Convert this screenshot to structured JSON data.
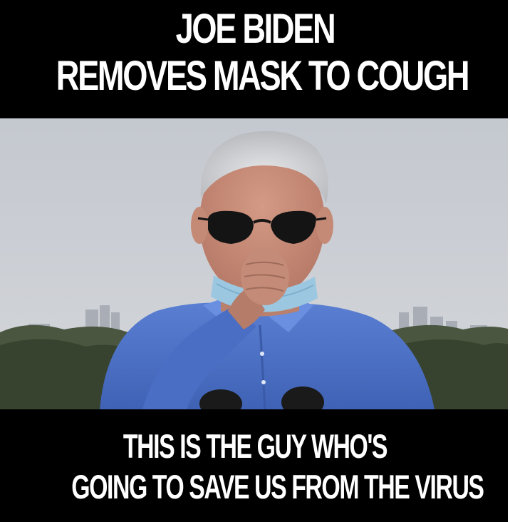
{
  "meme": {
    "top_caption": [
      "JOE BIDEN",
      "REMOVES MASK TO COUGH"
    ],
    "bottom_caption": [
      "THIS IS THE GUY WHO'S",
      "GOING TO SAVE US FROM THE VIRUS"
    ]
  },
  "colors": {
    "background": "#000000",
    "caption_text": "#ffffff",
    "sky": "#c9cdd4",
    "shirt": "#4f74c9",
    "mask": "#9cc7e0",
    "trees": "#3e4a33"
  }
}
